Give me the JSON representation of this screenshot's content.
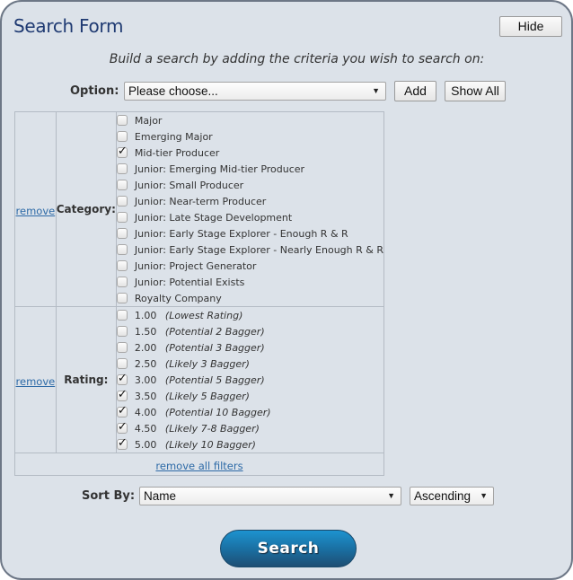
{
  "header": {
    "title": "Search Form",
    "hide_label": "Hide"
  },
  "instructions": "Build a search by adding the criteria you wish to search on:",
  "option_row": {
    "label": "Option:",
    "select_value": "Please choose...",
    "add_label": "Add",
    "show_all_label": "Show All"
  },
  "filters": [
    {
      "remove_label": "remove",
      "label": "Category:",
      "options": [
        {
          "text": "Major",
          "checked": false
        },
        {
          "text": "Emerging Major",
          "checked": false
        },
        {
          "text": "Mid-tier Producer",
          "checked": true
        },
        {
          "text": "Junior: Emerging Mid-tier Producer",
          "checked": false
        },
        {
          "text": "Junior: Small Producer",
          "checked": false
        },
        {
          "text": "Junior: Near-term Producer",
          "checked": false
        },
        {
          "text": "Junior: Late Stage Development",
          "checked": false
        },
        {
          "text": "Junior: Early Stage Explorer - Enough R & R",
          "checked": false
        },
        {
          "text": "Junior: Early Stage Explorer - Nearly Enough R & R",
          "checked": false
        },
        {
          "text": "Junior: Project Generator",
          "checked": false
        },
        {
          "text": "Junior: Potential Exists",
          "checked": false
        },
        {
          "text": "Royalty Company",
          "checked": false
        }
      ]
    },
    {
      "remove_label": "remove",
      "label": "Rating:",
      "options": [
        {
          "value": "1.00",
          "desc": "(Lowest Rating)",
          "checked": false
        },
        {
          "value": "1.50",
          "desc": "(Potential 2 Bagger)",
          "checked": false
        },
        {
          "value": "2.00",
          "desc": "(Potential 3 Bagger)",
          "checked": false
        },
        {
          "value": "2.50",
          "desc": "(Likely 3 Bagger)",
          "checked": false
        },
        {
          "value": "3.00",
          "desc": "(Potential 5 Bagger)",
          "checked": true
        },
        {
          "value": "3.50",
          "desc": "(Likely 5 Bagger)",
          "checked": true
        },
        {
          "value": "4.00",
          "desc": "(Potential 10 Bagger)",
          "checked": true
        },
        {
          "value": "4.50",
          "desc": "(Likely 7-8 Bagger)",
          "checked": true
        },
        {
          "value": "5.00",
          "desc": "(Likely 10 Bagger)",
          "checked": true
        }
      ]
    }
  ],
  "remove_all_label": "remove all filters",
  "sort": {
    "label": "Sort By:",
    "field_value": "Name",
    "order_value": "Ascending"
  },
  "search_label": "Search",
  "colors": {
    "panel_bg": "#dce2e9",
    "title": "#1f3a72",
    "link": "#2d6aa7",
    "search_button": "#1a6d9f"
  }
}
